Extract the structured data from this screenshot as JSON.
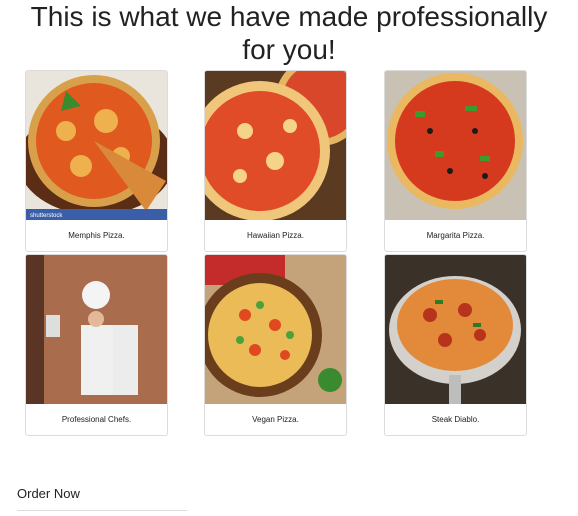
{
  "page": {
    "title": "This is what we have made professionally for you!",
    "order_label": "Order Now"
  },
  "cards": [
    {
      "caption": "Memphis Pizza.",
      "watermark": "shutterstock",
      "image": "pizza-slices-photo"
    },
    {
      "caption": "Hawaiian Pizza.",
      "image": "pizza-photo"
    },
    {
      "caption": "Margarita Pizza.",
      "image": "pizza-photo"
    },
    {
      "caption": "Professional Chefs.",
      "image": "chef-photo"
    },
    {
      "caption": "Vegan Pizza.",
      "image": "pizza-photo"
    },
    {
      "caption": "Steak Diablo.",
      "image": "pizza-on-stand-photo"
    }
  ]
}
